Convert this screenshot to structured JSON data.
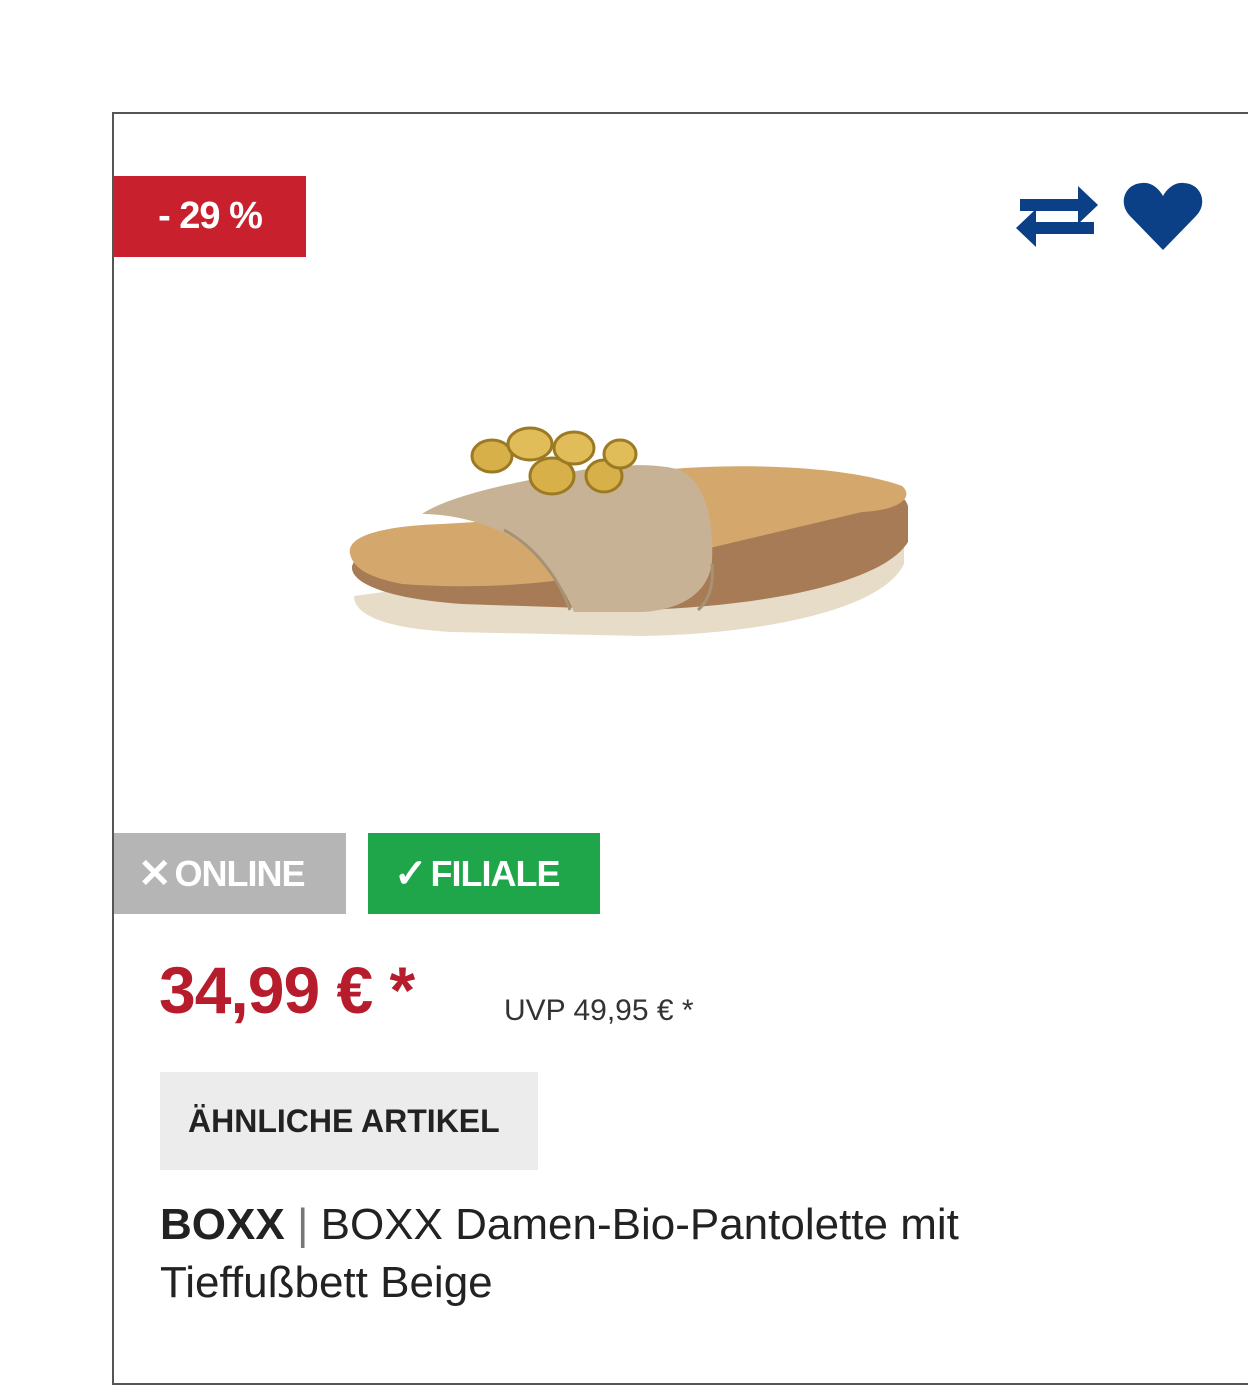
{
  "badge": {
    "discount": "- 29 %"
  },
  "availability": {
    "online": {
      "label": "ONLINE",
      "mark": "✕",
      "available": false
    },
    "store": {
      "label": "FILIALE",
      "mark": "✓",
      "available": true
    }
  },
  "price": {
    "current": "34,99 € *",
    "uvp": "UVP 49,95 € *"
  },
  "actions": {
    "similar_label": "ÄHNLICHE ARTIKEL"
  },
  "product": {
    "brand": "BOXX",
    "separator": "|",
    "name": "BOXX Damen-Bio-Pantolette mit Tieffußbett Beige"
  },
  "icons": {
    "compare": "compare-arrows-icon",
    "favorite": "heart-icon"
  },
  "colors": {
    "discount_bg": "#c8202c",
    "price": "#b71c2c",
    "online_bg": "#b5b5b5",
    "store_bg": "#1fa64a",
    "icon_blue": "#0b3f86"
  }
}
